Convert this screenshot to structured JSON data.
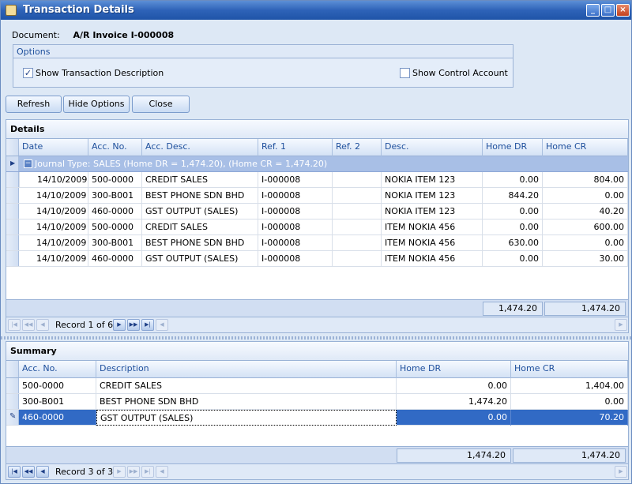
{
  "window": {
    "title": "Transaction Details"
  },
  "document": {
    "label": "Document:",
    "value": "A/R Invoice I-000008"
  },
  "options": {
    "header": "Options",
    "show_desc": "Show Transaction Description",
    "show_desc_checked": "✓",
    "show_control": "Show Control Account"
  },
  "buttons": {
    "refresh": "Refresh",
    "hide_options": "Hide Options",
    "close": "Close"
  },
  "details": {
    "header": "Details",
    "columns": [
      "Date",
      "Acc. No.",
      "Acc. Desc.",
      "Ref. 1",
      "Ref. 2",
      "Desc.",
      "Home DR",
      "Home CR"
    ],
    "group": "Journal Type: SALES (Home DR = 1,474.20), (Home CR = 1,474.20)",
    "rows": [
      [
        "14/10/2009",
        "500-0000",
        "CREDIT SALES",
        "I-000008",
        "",
        "NOKIA ITEM 123",
        "0.00",
        "804.00"
      ],
      [
        "14/10/2009",
        "300-B001",
        "BEST PHONE SDN BHD",
        "I-000008",
        "",
        "NOKIA ITEM 123",
        "844.20",
        "0.00"
      ],
      [
        "14/10/2009",
        "460-0000",
        "GST OUTPUT (SALES)",
        "I-000008",
        "",
        "NOKIA ITEM 123",
        "0.00",
        "40.20"
      ],
      [
        "14/10/2009",
        "500-0000",
        "CREDIT SALES",
        "I-000008",
        "",
        "ITEM NOKIA 456",
        "0.00",
        "600.00"
      ],
      [
        "14/10/2009",
        "300-B001",
        "BEST PHONE SDN BHD",
        "I-000008",
        "",
        "ITEM NOKIA 456",
        "630.00",
        "0.00"
      ],
      [
        "14/10/2009",
        "460-0000",
        "GST OUTPUT (SALES)",
        "I-000008",
        "",
        "ITEM NOKIA 456",
        "0.00",
        "30.00"
      ]
    ],
    "total_dr": "1,474.20",
    "total_cr": "1,474.20",
    "record_text": "Record 1 of 6"
  },
  "summary": {
    "header": "Summary",
    "columns": [
      "Acc. No.",
      "Description",
      "Home DR",
      "Home CR"
    ],
    "rows": [
      [
        "500-0000",
        "CREDIT SALES",
        "0.00",
        "1,404.00"
      ],
      [
        "300-B001",
        "BEST PHONE SDN BHD",
        "1,474.20",
        "0.00"
      ],
      [
        "460-0000",
        "GST OUTPUT (SALES)",
        "0.00",
        "70.20"
      ]
    ],
    "total_dr": "1,474.20",
    "total_cr": "1,474.20",
    "record_text": "Record 3 of 3"
  }
}
